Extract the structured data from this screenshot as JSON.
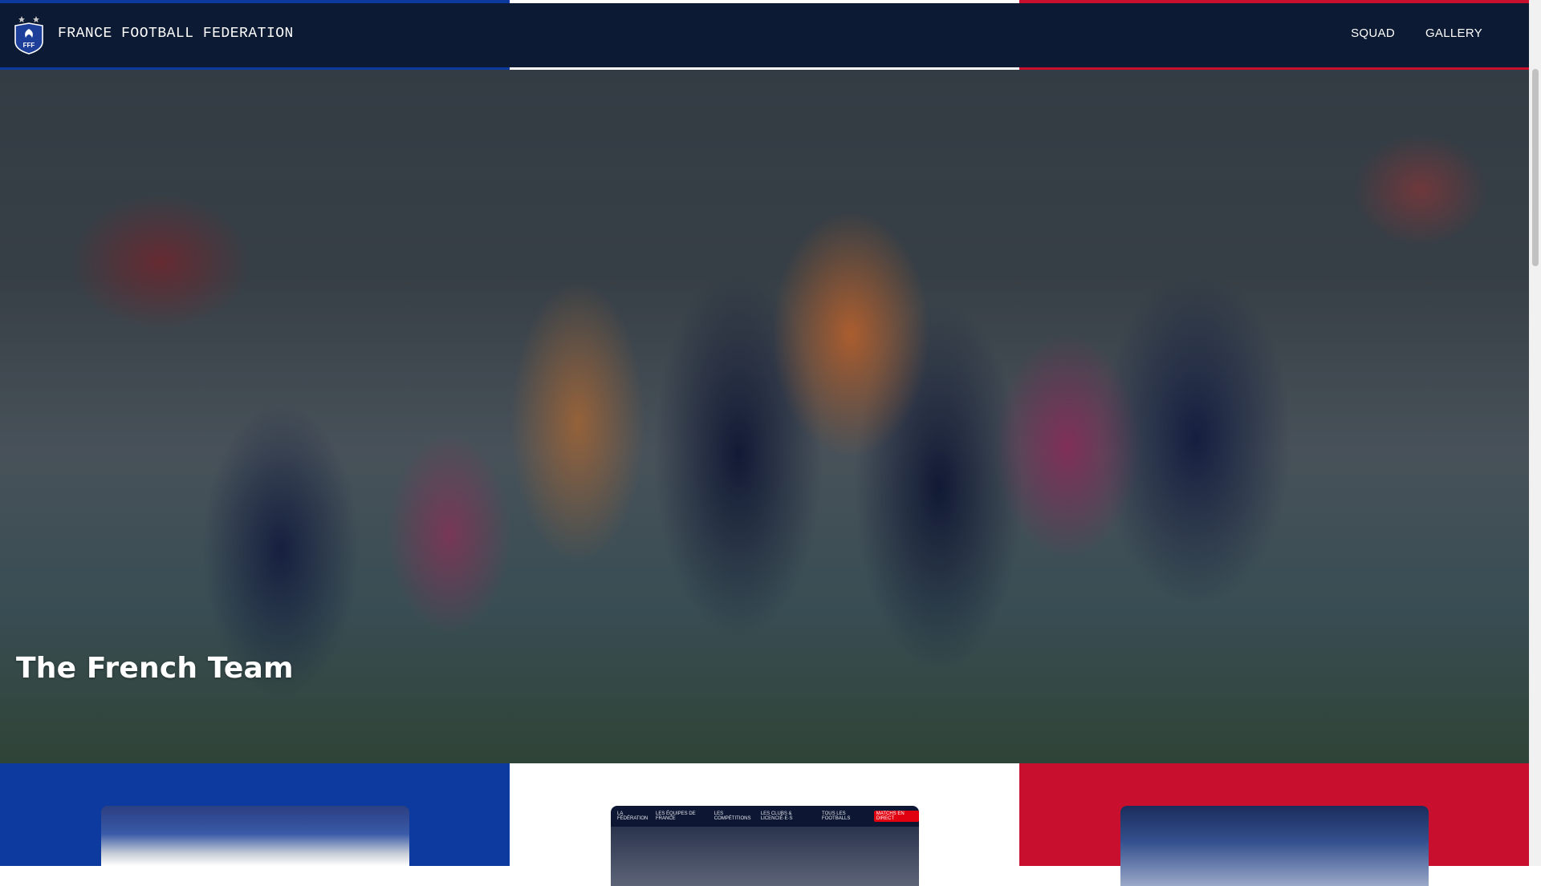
{
  "header": {
    "brand": "FRANCE FOOTBALL FEDERATION",
    "logo_icon": "fff-crest-icon",
    "nav": [
      {
        "label": "SQUAD"
      },
      {
        "label": "GALLERY"
      }
    ]
  },
  "hero": {
    "title": "The French Team"
  },
  "sections": [
    {
      "color": "#0d3a9e",
      "thumbnail": "squad-photo"
    },
    {
      "color": "#ffffff",
      "thumbnail": "website-preview",
      "thumb_nav": [
        "LA FÉDÉRATION",
        "LES ÉQUIPES DE FRANCE",
        "LES COMPÉTITIONS",
        "LES CLUBS & LICENCIÉ·E·S",
        "TOUS LES FOOTBALLS",
        "MATCHS EN DIRECT"
      ]
    },
    {
      "color": "#c8102e",
      "thumbnail": "gallery-photo"
    }
  ],
  "colors": {
    "blue": "#0d3a9e",
    "white": "#ffffff",
    "red": "#c8102e",
    "navy": "#0c1a33"
  }
}
